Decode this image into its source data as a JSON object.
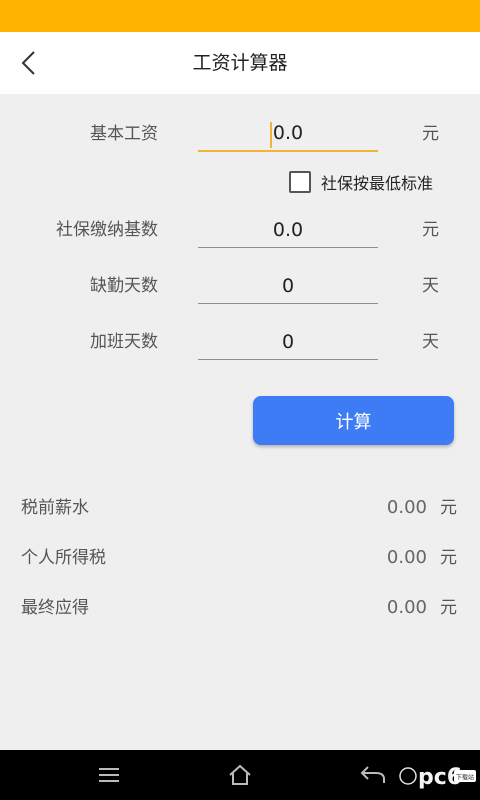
{
  "header": {
    "title": "工资计算器",
    "back_icon": "chevron-left-icon"
  },
  "form": {
    "base_salary": {
      "label": "基本工资",
      "value": "0.0",
      "unit": "元"
    },
    "min_social_checkbox": {
      "label": "社保按最低标准",
      "checked": false
    },
    "social_base": {
      "label": "社保缴纳基数",
      "value": "0.0",
      "unit": "元"
    },
    "absent_days": {
      "label": "缺勤天数",
      "value": "0",
      "unit": "天"
    },
    "overtime_days": {
      "label": "加班天数",
      "value": "0",
      "unit": "天"
    }
  },
  "calculate_label": "计算",
  "results": [
    {
      "label": "税前薪水",
      "value": "0.00",
      "unit": "元"
    },
    {
      "label": "个人所得税",
      "value": "0.00",
      "unit": "元"
    },
    {
      "label": "最终应得",
      "value": "0.00",
      "unit": "元"
    }
  ],
  "nav": {
    "menu_icon": "menu-icon",
    "home_icon": "home-icon",
    "back_icon": "back-arrow-icon"
  },
  "watermark": {
    "brand": "pc6",
    "badge": "下载站"
  },
  "colors": {
    "status_bar": "#ffb300",
    "accent": "#f0b43a",
    "button": "#3d7cf4"
  }
}
